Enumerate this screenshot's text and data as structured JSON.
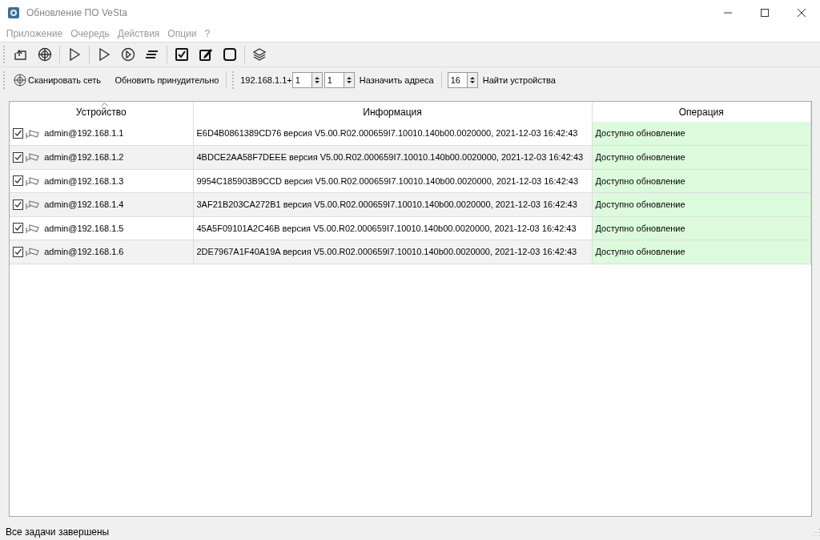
{
  "window": {
    "title": "Обновление ПО VeSta"
  },
  "menu": [
    "Приложение",
    "Очередь",
    "Действия",
    "Опции",
    "?"
  ],
  "scan_toolbar": {
    "scan_button": "Сканировать сеть",
    "force_button": "Обновить принудительно",
    "ip_prefix": "192.168.1.1+",
    "start": "1",
    "count": "1",
    "assign_button": "Назначить адреса",
    "threads": "16",
    "find_button": "Найти устройства"
  },
  "table": {
    "columns": [
      "Устройство",
      "Информация",
      "Операция"
    ],
    "rows": [
      {
        "checked": true,
        "device": "admin@192.168.1.1",
        "info": "E6D4B0861389CD76 версия V5.00.R02.000659I7.10010.140b00.0020000, 2021-12-03 16:42:43",
        "operation": "Доступно обновление"
      },
      {
        "checked": true,
        "device": "admin@192.168.1.2",
        "info": "4BDCE2AA58F7DEEE версия V5.00.R02.000659I7.10010.140b00.0020000, 2021-12-03 16:42:43",
        "operation": "Доступно обновление"
      },
      {
        "checked": true,
        "device": "admin@192.168.1.3",
        "info": "9954C185903B9CCD версия V5.00.R02.000659I7.10010.140b00.0020000, 2021-12-03 16:42:43",
        "operation": "Доступно обновление"
      },
      {
        "checked": true,
        "device": "admin@192.168.1.4",
        "info": "3AF21B203CA272B1 версия V5.00.R02.000659I7.10010.140b00.0020000, 2021-12-03 16:42:43",
        "operation": "Доступно обновление"
      },
      {
        "checked": true,
        "device": "admin@192.168.1.5",
        "info": "45A5F09101A2C46B версия V5.00.R02.000659I7.10010.140b00.0020000, 2021-12-03 16:42:43",
        "operation": "Доступно обновление"
      },
      {
        "checked": true,
        "device": "admin@192.168.1.6",
        "info": "2DE7967A1F40A19A версия V5.00.R02.000659I7.10010.140b00.0020000, 2021-12-03 16:42:43",
        "operation": "Доступно обновление"
      }
    ]
  },
  "status_bar": "Все задачи завершены"
}
